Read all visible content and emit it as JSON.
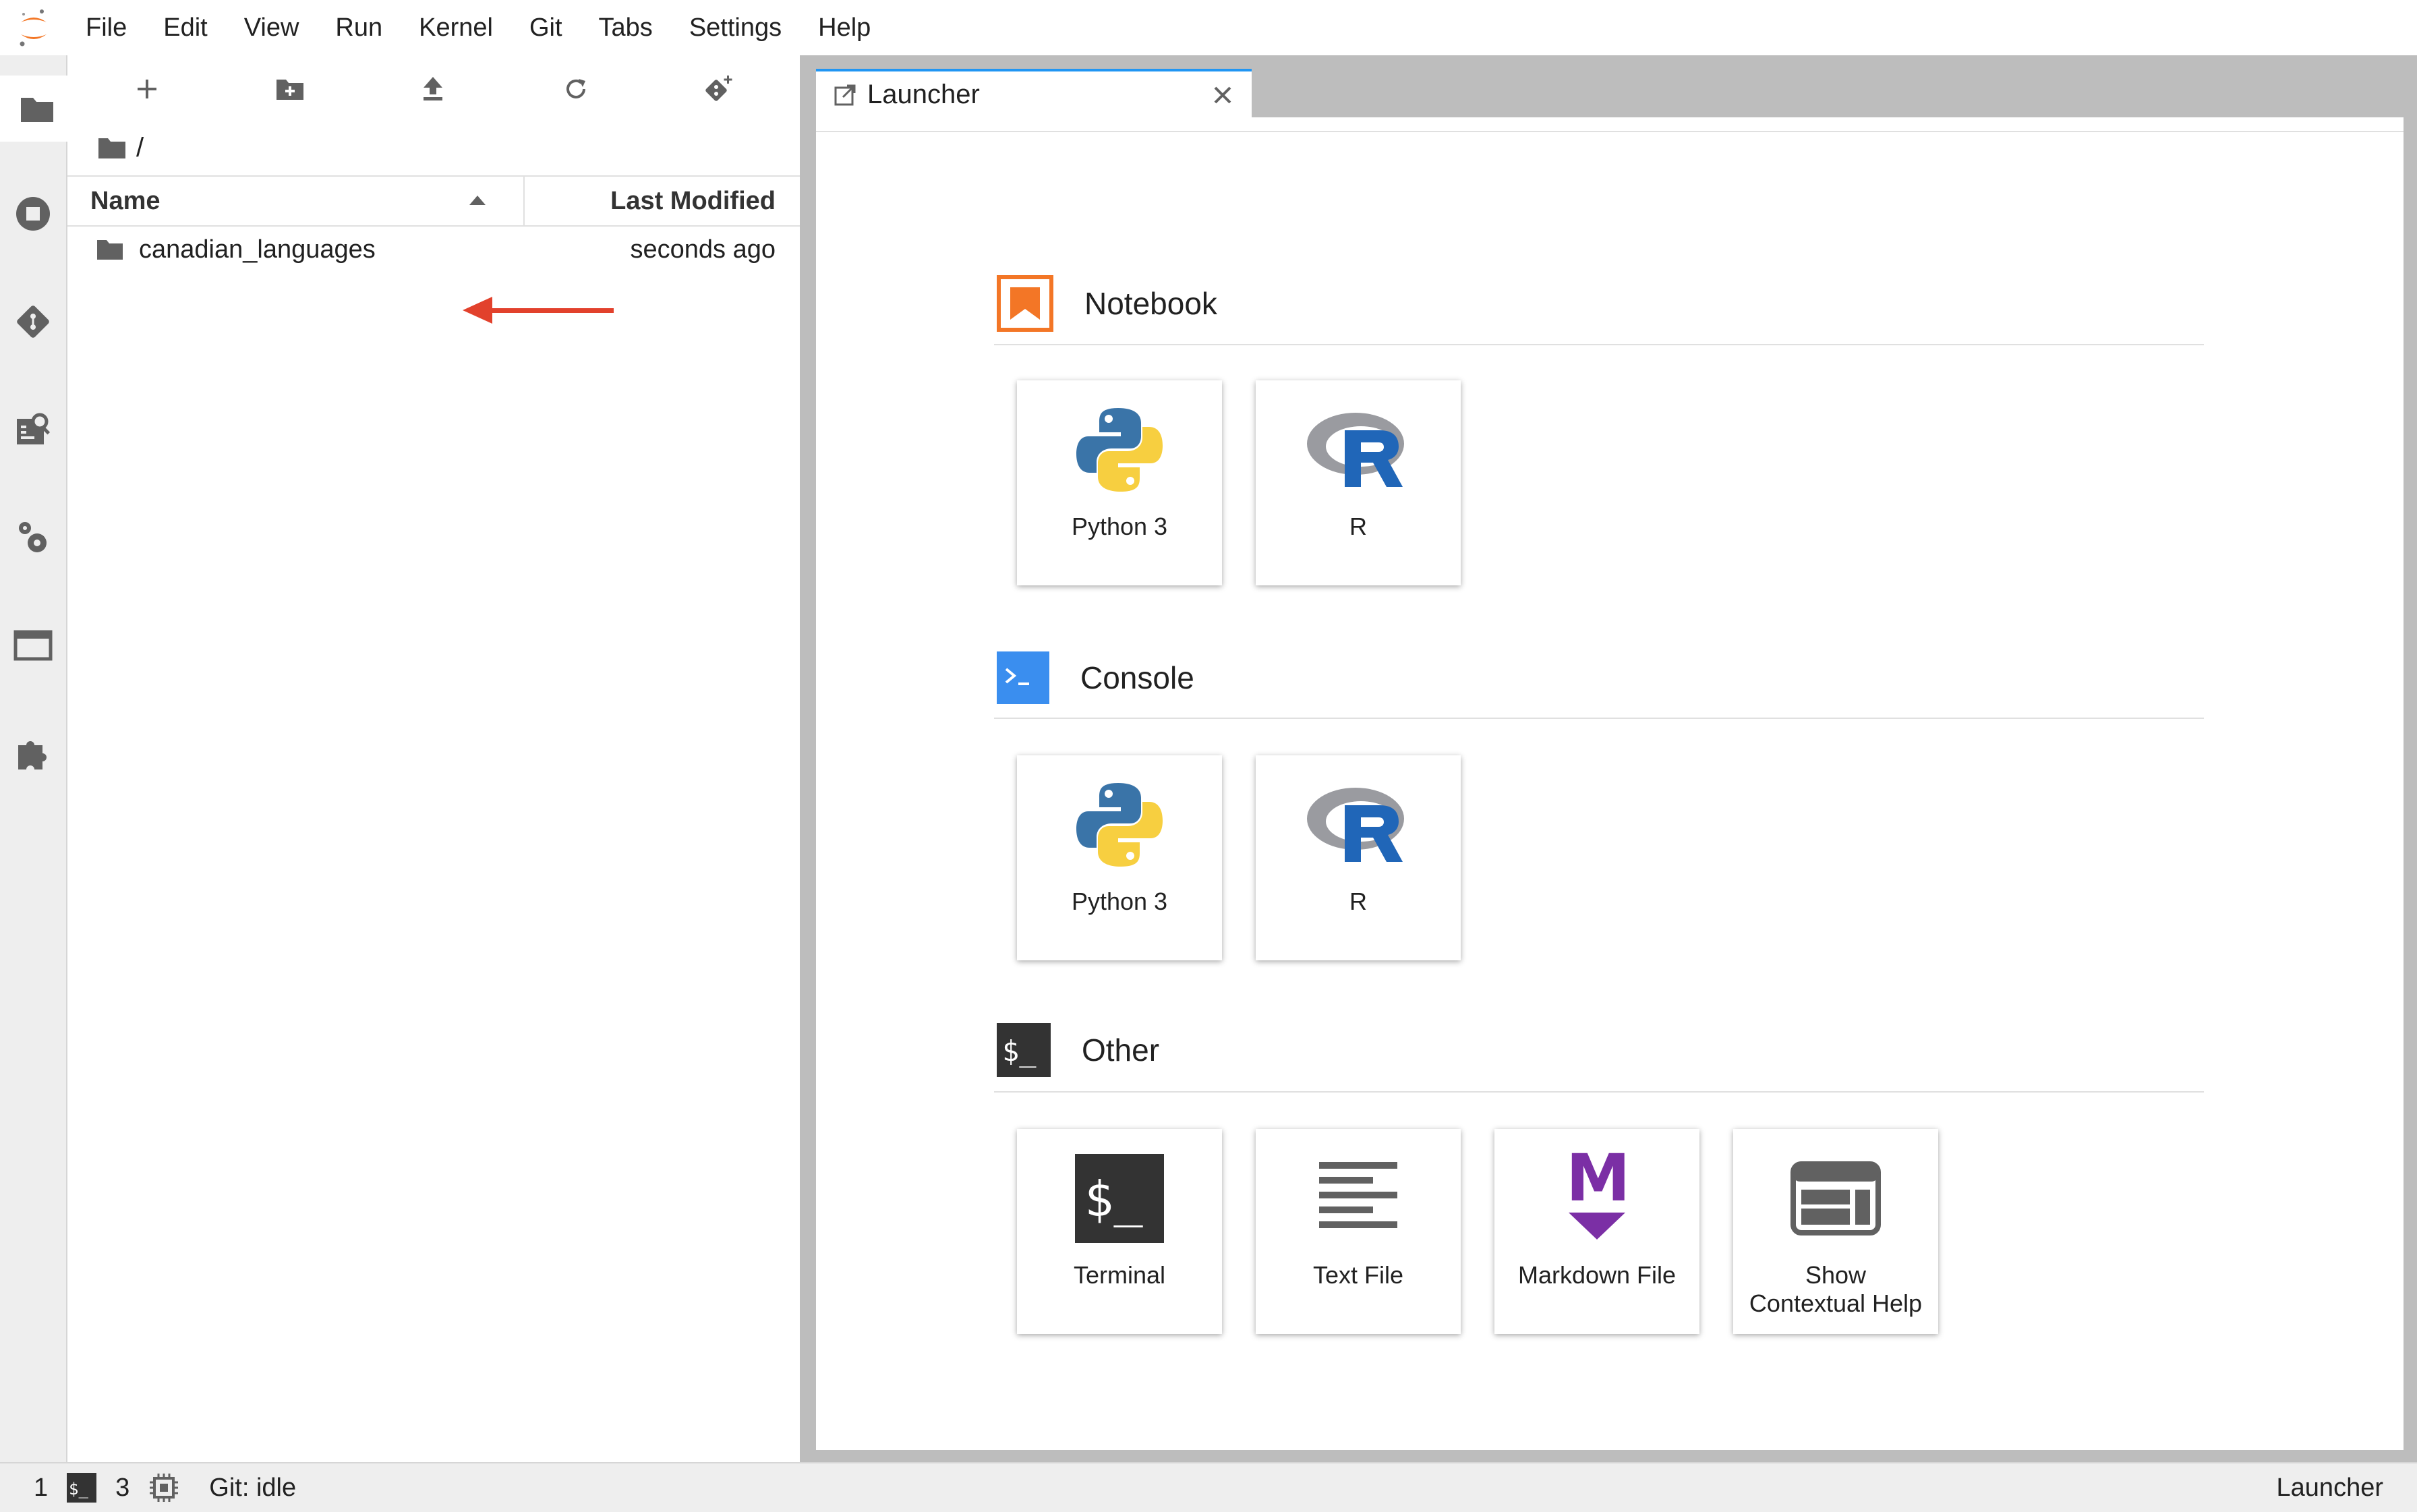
{
  "menubar": {
    "items": [
      "File",
      "Edit",
      "View",
      "Run",
      "Kernel",
      "Git",
      "Tabs",
      "Settings",
      "Help"
    ]
  },
  "activitybar": {
    "icons": [
      "folder-icon",
      "running-icon",
      "git-icon",
      "property-inspector-icon",
      "settings-icon",
      "tabs-icon",
      "extensions-icon"
    ]
  },
  "filebrowser": {
    "breadcrumb": "/",
    "columns": {
      "name": "Name",
      "modified": "Last Modified"
    },
    "rows": [
      {
        "name": "canadian_languages",
        "modified": "seconds ago"
      }
    ]
  },
  "tabs": [
    {
      "title": "Launcher"
    }
  ],
  "launcher": {
    "sections": [
      {
        "title": "Notebook",
        "cards": [
          {
            "label": "Python 3"
          },
          {
            "label": "R"
          }
        ]
      },
      {
        "title": "Console",
        "cards": [
          {
            "label": "Python 3"
          },
          {
            "label": "R"
          }
        ]
      },
      {
        "title": "Other",
        "cards": [
          {
            "label": "Terminal"
          },
          {
            "label": "Text File"
          },
          {
            "label": "Markdown File"
          },
          {
            "label": "Show Contextual Help"
          }
        ]
      }
    ]
  },
  "statusbar": {
    "kernels_count": "1",
    "terminals_count": "3",
    "git_status": "Git: idle",
    "current_activity": "Launcher"
  },
  "colors": {
    "accent": "#2196f3",
    "notebook_orange": "#f37626",
    "console_blue": "#3a8eef",
    "markdown_purple": "#7b2fa5",
    "annotation_arrow": "#e2412c"
  }
}
